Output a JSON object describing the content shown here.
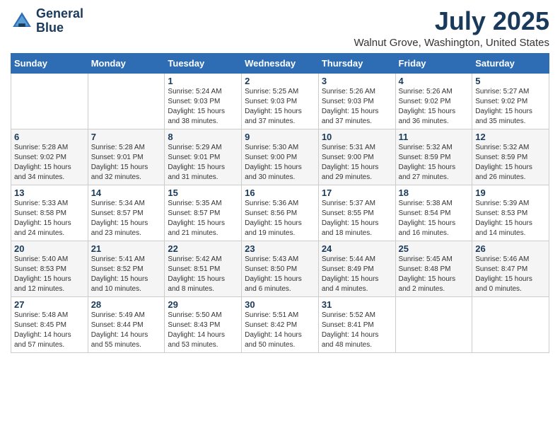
{
  "logo": {
    "line1": "General",
    "line2": "Blue"
  },
  "title": "July 2025",
  "subtitle": "Walnut Grove, Washington, United States",
  "days_of_week": [
    "Sunday",
    "Monday",
    "Tuesday",
    "Wednesday",
    "Thursday",
    "Friday",
    "Saturday"
  ],
  "weeks": [
    [
      {
        "num": "",
        "info": ""
      },
      {
        "num": "",
        "info": ""
      },
      {
        "num": "1",
        "info": "Sunrise: 5:24 AM\nSunset: 9:03 PM\nDaylight: 15 hours and 38 minutes."
      },
      {
        "num": "2",
        "info": "Sunrise: 5:25 AM\nSunset: 9:03 PM\nDaylight: 15 hours and 37 minutes."
      },
      {
        "num": "3",
        "info": "Sunrise: 5:26 AM\nSunset: 9:03 PM\nDaylight: 15 hours and 37 minutes."
      },
      {
        "num": "4",
        "info": "Sunrise: 5:26 AM\nSunset: 9:02 PM\nDaylight: 15 hours and 36 minutes."
      },
      {
        "num": "5",
        "info": "Sunrise: 5:27 AM\nSunset: 9:02 PM\nDaylight: 15 hours and 35 minutes."
      }
    ],
    [
      {
        "num": "6",
        "info": "Sunrise: 5:28 AM\nSunset: 9:02 PM\nDaylight: 15 hours and 34 minutes."
      },
      {
        "num": "7",
        "info": "Sunrise: 5:28 AM\nSunset: 9:01 PM\nDaylight: 15 hours and 32 minutes."
      },
      {
        "num": "8",
        "info": "Sunrise: 5:29 AM\nSunset: 9:01 PM\nDaylight: 15 hours and 31 minutes."
      },
      {
        "num": "9",
        "info": "Sunrise: 5:30 AM\nSunset: 9:00 PM\nDaylight: 15 hours and 30 minutes."
      },
      {
        "num": "10",
        "info": "Sunrise: 5:31 AM\nSunset: 9:00 PM\nDaylight: 15 hours and 29 minutes."
      },
      {
        "num": "11",
        "info": "Sunrise: 5:32 AM\nSunset: 8:59 PM\nDaylight: 15 hours and 27 minutes."
      },
      {
        "num": "12",
        "info": "Sunrise: 5:32 AM\nSunset: 8:59 PM\nDaylight: 15 hours and 26 minutes."
      }
    ],
    [
      {
        "num": "13",
        "info": "Sunrise: 5:33 AM\nSunset: 8:58 PM\nDaylight: 15 hours and 24 minutes."
      },
      {
        "num": "14",
        "info": "Sunrise: 5:34 AM\nSunset: 8:57 PM\nDaylight: 15 hours and 23 minutes."
      },
      {
        "num": "15",
        "info": "Sunrise: 5:35 AM\nSunset: 8:57 PM\nDaylight: 15 hours and 21 minutes."
      },
      {
        "num": "16",
        "info": "Sunrise: 5:36 AM\nSunset: 8:56 PM\nDaylight: 15 hours and 19 minutes."
      },
      {
        "num": "17",
        "info": "Sunrise: 5:37 AM\nSunset: 8:55 PM\nDaylight: 15 hours and 18 minutes."
      },
      {
        "num": "18",
        "info": "Sunrise: 5:38 AM\nSunset: 8:54 PM\nDaylight: 15 hours and 16 minutes."
      },
      {
        "num": "19",
        "info": "Sunrise: 5:39 AM\nSunset: 8:53 PM\nDaylight: 15 hours and 14 minutes."
      }
    ],
    [
      {
        "num": "20",
        "info": "Sunrise: 5:40 AM\nSunset: 8:53 PM\nDaylight: 15 hours and 12 minutes."
      },
      {
        "num": "21",
        "info": "Sunrise: 5:41 AM\nSunset: 8:52 PM\nDaylight: 15 hours and 10 minutes."
      },
      {
        "num": "22",
        "info": "Sunrise: 5:42 AM\nSunset: 8:51 PM\nDaylight: 15 hours and 8 minutes."
      },
      {
        "num": "23",
        "info": "Sunrise: 5:43 AM\nSunset: 8:50 PM\nDaylight: 15 hours and 6 minutes."
      },
      {
        "num": "24",
        "info": "Sunrise: 5:44 AM\nSunset: 8:49 PM\nDaylight: 15 hours and 4 minutes."
      },
      {
        "num": "25",
        "info": "Sunrise: 5:45 AM\nSunset: 8:48 PM\nDaylight: 15 hours and 2 minutes."
      },
      {
        "num": "26",
        "info": "Sunrise: 5:46 AM\nSunset: 8:47 PM\nDaylight: 15 hours and 0 minutes."
      }
    ],
    [
      {
        "num": "27",
        "info": "Sunrise: 5:48 AM\nSunset: 8:45 PM\nDaylight: 14 hours and 57 minutes."
      },
      {
        "num": "28",
        "info": "Sunrise: 5:49 AM\nSunset: 8:44 PM\nDaylight: 14 hours and 55 minutes."
      },
      {
        "num": "29",
        "info": "Sunrise: 5:50 AM\nSunset: 8:43 PM\nDaylight: 14 hours and 53 minutes."
      },
      {
        "num": "30",
        "info": "Sunrise: 5:51 AM\nSunset: 8:42 PM\nDaylight: 14 hours and 50 minutes."
      },
      {
        "num": "31",
        "info": "Sunrise: 5:52 AM\nSunset: 8:41 PM\nDaylight: 14 hours and 48 minutes."
      },
      {
        "num": "",
        "info": ""
      },
      {
        "num": "",
        "info": ""
      }
    ]
  ]
}
